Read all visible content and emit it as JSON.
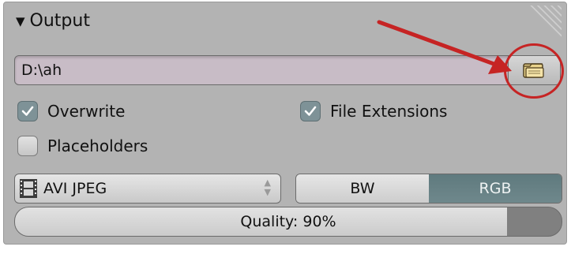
{
  "panel": {
    "title": "Output",
    "collapse_icon": "triangle-down-icon"
  },
  "output_path": {
    "value": "D:\\ah",
    "browse_icon": "folder-icon"
  },
  "options": {
    "overwrite": {
      "label": "Overwrite",
      "checked": true
    },
    "file_extensions": {
      "label": "File Extensions",
      "checked": true
    },
    "placeholders": {
      "label": "Placeholders",
      "checked": false
    }
  },
  "file_format": {
    "selected": "AVI JPEG",
    "icon": "film-icon"
  },
  "color_mode": {
    "options": [
      "BW",
      "RGB"
    ],
    "selected": "RGB"
  },
  "quality": {
    "label": "Quality: 90%",
    "value_percent": 90
  },
  "annotation": {
    "color": "#c62424"
  },
  "colors": {
    "panel_bg": "#b3b3b3",
    "path_bg": "#c8bcc6",
    "accent": "#6f888c"
  }
}
